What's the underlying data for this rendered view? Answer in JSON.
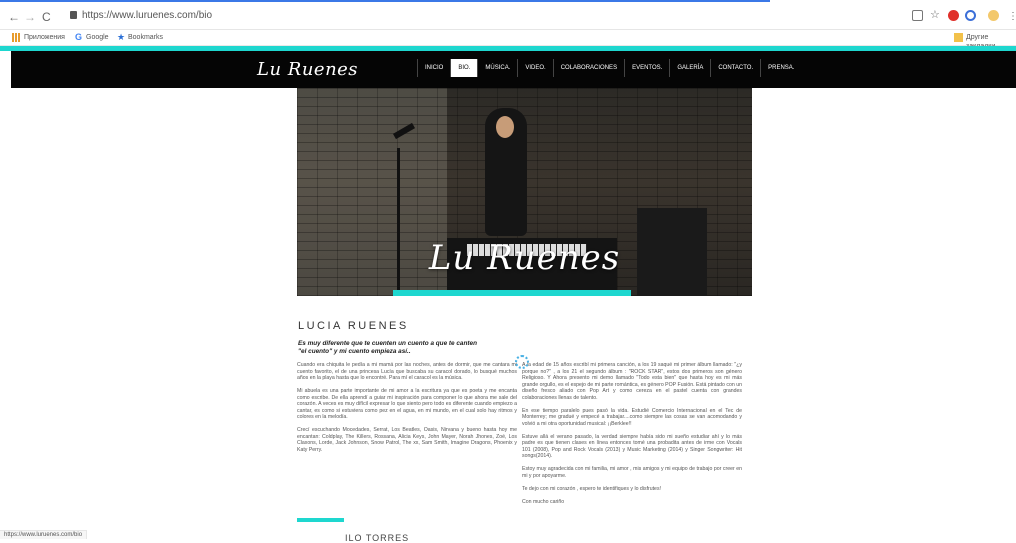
{
  "browser": {
    "url": "https://www.luruenes.com/bio",
    "nav": {
      "back": "←",
      "forward": "→",
      "reload": "C"
    },
    "bookmarks": [
      {
        "label": "Приложения",
        "icon": "apps-icon"
      },
      {
        "label": "Google",
        "icon": "google-icon"
      },
      {
        "label": "Bookmarks",
        "icon": "star-icon"
      }
    ],
    "other_bookmarks": "Другие закладки",
    "status_url": "https://www.luruenes.com/bio"
  },
  "site": {
    "logo": "Lu Ruenes",
    "menu": [
      {
        "label": "INICIO",
        "active": false
      },
      {
        "label": "BIO.",
        "active": true
      },
      {
        "label": "MÚSICA.",
        "active": false
      },
      {
        "label": "VIDEO.",
        "active": false
      },
      {
        "label": "COLABORACIONES",
        "active": false
      },
      {
        "label": "EVENTOS.",
        "active": false
      },
      {
        "label": "GALERÍA",
        "active": false
      },
      {
        "label": "CONTACTO.",
        "active": false
      },
      {
        "label": "PRENSA.",
        "active": false
      }
    ],
    "hero_logo": "Lu Ruenes"
  },
  "bio": {
    "name": "LUCIA RUENES",
    "quote_line1": "Es muy diferente que te cuenten un cuento a que te canten",
    "quote_line2": "\"el cuento\" y mi cuento empieza así..",
    "col1": [
      "Cuando era chiquita le pedía a mi mamá por las noches, antes de dormir, que me cantara mi cuento favorito, el de una princesa Lucía que buscaba su caracol dorado, lo busqué muchos años en la playa hasta que lo encontré. Para mí el caracol es la música.",
      "Mi abuela es una parte importante de mi amor a la escritura ya que es poeta y me encanta como escribe. De ella aprendí a guiar mi inspiración para componer lo que ahora me sale del corazón. A veces es muy difícil expresar lo que siento pero todo es diferente cuando empiezo a cantar, es como si estuviera como pez en el agua, en mi mundo, en el cual solo hay ritmos y colores en la melodía.",
      "Crecí escuchando Mocedades, Serrat, Los Beatles, Oasis, Nirvana y bueno hasta hoy me encantan: Coldplay, The Killers, Rossana, Alicia Keys, John Mayer, Norah Jhones, Zoé, Los Claxons, Lorde, Jack Johnson, Snow Patrol, The xx, Sam Smith, Imagine Dragons, Phoenix y Katy Perry."
    ],
    "col2": [
      "A la edad de 15 años escribí mi primera canción, a los 19 saqué mi primer álbum llamado: \"¿y porque no?\" , a los 21 el segundo álbum : \"ROCK STAR\", estos dos primeros son género Religioso. Y Ahora presento mi demo llamado \"Todo esta bien\" que hasta hoy es mi más grande orgullo, es el espejo de mi parte romántica, es género POP Fusión. Está pintado con un diseño fresco aliado con Pop Art y como cereza en el pastel cuenta con grandes colaboraciones llenas de talento.",
      "En ese tiempo paralelo pues pasó la vida. Estudié Comercio Internacional en el Tec de Monterrey; me gradué y empecé a trabajar....como siempre las cosas se van acomodando y volvió a mi otra oportunidad musical: ¡¡Berklee!!",
      "Estuve allá el verano pasado, la verdad siempre había sido mi sueño estudiar ahí y lo más padre es que tienen clases en línea entonces tomé una probadita antes de irme con Vocals 101 (2008), Pop and Rock Vocals (2013) y Music Marketing (2014) y Singer Songwriter: Hit songs(2014).",
      "Estoy muy agradecida con mi familia, mi amor , mis amigos y  mi equipo de trabajo por creer en mi y por apoyarme.",
      "Te dejo con mi corazón , espero te identifiques y lo disfrutes!",
      "Con mucho cariño"
    ],
    "next_name": "ILO TORRES"
  },
  "colors": {
    "accent": "#1ed7cf",
    "nav_bg": "#050505"
  }
}
